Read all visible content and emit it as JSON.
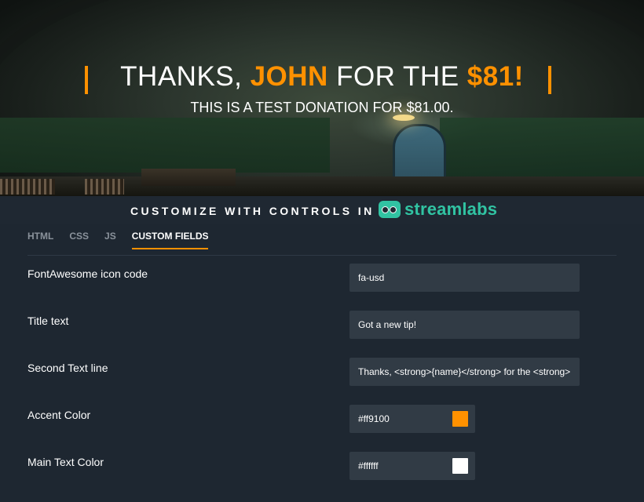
{
  "hero": {
    "headline_pre": "THANKS, ",
    "headline_name": "JOHN",
    "headline_mid": " FOR THE ",
    "headline_amount": "$81!",
    "subline": "THIS IS A TEST DONATION FOR $81.00."
  },
  "banner": {
    "text": "CUSTOMIZE WITH CONTROLS IN",
    "logo_text": "streamlabs",
    "logo_icon": "streamlabs-logo-icon"
  },
  "tabs": [
    {
      "label": "HTML"
    },
    {
      "label": "CSS"
    },
    {
      "label": "JS"
    },
    {
      "label": "CUSTOM FIELDS"
    }
  ],
  "active_tab": "CUSTOM FIELDS",
  "fields": {
    "icon_code": {
      "label": "FontAwesome icon code",
      "value": "fa-usd"
    },
    "title_text": {
      "label": "Title text",
      "value": "Got a new tip!"
    },
    "second_line": {
      "label": "Second Text line",
      "value": "Thanks, <strong>{name}</strong> for the <strong>"
    },
    "accent_color": {
      "label": "Accent Color",
      "value": "#ff9100"
    },
    "main_text_color": {
      "label": "Main Text Color",
      "value": "#ffffff"
    }
  },
  "colors": {
    "accent": "#ff9100",
    "main_text": "#ffffff",
    "brand": "#31c3a2",
    "panel_bg": "#1e2731"
  }
}
